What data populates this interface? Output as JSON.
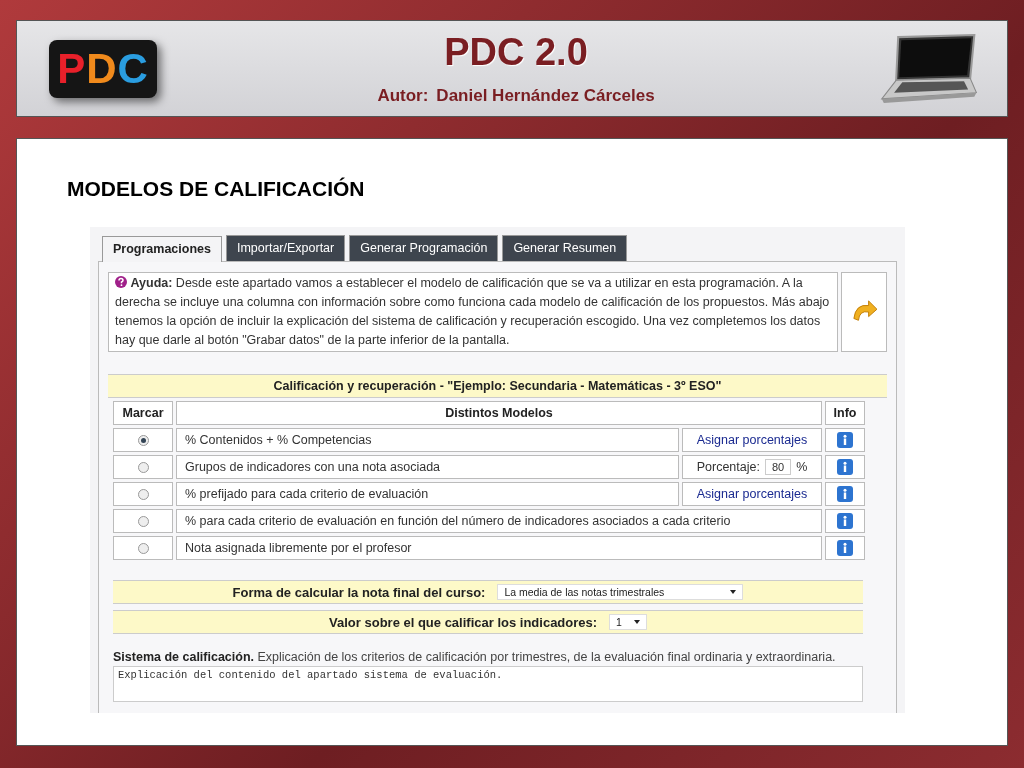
{
  "header": {
    "logo": [
      {
        "letter": "P",
        "color": "#e8202a"
      },
      {
        "letter": "D",
        "color": "#f08a1c"
      },
      {
        "letter": "C",
        "color": "#2a9de0"
      }
    ],
    "title": "PDC 2.0",
    "author_label": "Autor:",
    "author": "Daniel Hernández Cárceles"
  },
  "heading": "MODELOS DE CALIFICACIÓN",
  "tabs": [
    {
      "label": "Programaciones",
      "selected": true
    },
    {
      "label": "Importar/Exportar",
      "selected": false
    },
    {
      "label": "Generar Programación",
      "selected": false
    },
    {
      "label": "Generar Resumen",
      "selected": false
    }
  ],
  "help": {
    "label": "Ayuda:",
    "text": "Desde este apartado vamos a establecer el modelo de calificación que se va a utilizar en esta programación. A la derecha se incluye una columna con información sobre como funciona cada modelo de calificación de los propuestos. Más abajo tenemos la opción de incluir la explicación del sistema de calificación y recuperación escogido. Una vez completemos los datos hay que darle al botón \"Grabar datos\" de la parte inferior de la pantalla."
  },
  "section_title": "Calificación y recuperación - \"Ejemplo: Secundaria - Matemáticas - 3º ESO\"",
  "table": {
    "columns": [
      "Marcar",
      "Distintos Modelos",
      "Info"
    ],
    "rows": [
      {
        "selected": true,
        "model": "% Contenidos + % Competencias",
        "kind": "link",
        "action": "Asignar porcentajes"
      },
      {
        "selected": false,
        "model": "Grupos de indicadores con una nota asociada",
        "kind": "percent",
        "action": "Porcentaje:",
        "value": "80",
        "unit": "%"
      },
      {
        "selected": false,
        "model": "% prefijado para cada criterio de evaluación",
        "kind": "link",
        "action": "Asignar porcentajes"
      },
      {
        "selected": false,
        "model": "% para cada criterio de evaluación en función del número de indicadores asociados a cada criterio",
        "kind": "plain"
      },
      {
        "selected": false,
        "model": "Nota asignada libremente por el profesor",
        "kind": "plain"
      }
    ]
  },
  "final_grade": {
    "label": "Forma de calcular la nota final del curso:",
    "value": "La media de las notas trimestrales"
  },
  "indicator_scale": {
    "label": "Valor sobre el que calificar los indicadores:",
    "value": "1"
  },
  "system": {
    "label": "Sistema de calificación.",
    "description": "Explicación de los criterios de calificación por trimestres, de la evaluación final ordinaria y extraordinaria.",
    "value": "Explicación del contenido del apartado sistema de evaluación."
  }
}
